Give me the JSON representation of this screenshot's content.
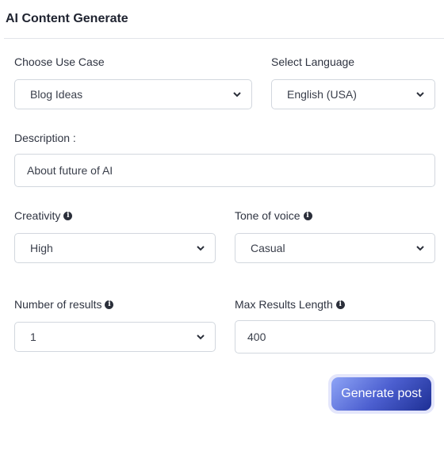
{
  "header": {
    "title": "AI Content Generate"
  },
  "form": {
    "use_case": {
      "label": "Choose Use Case",
      "value": "Blog Ideas"
    },
    "language": {
      "label": "Select Language",
      "value": "English (USA)"
    },
    "description": {
      "label": "Description :",
      "value": "About future of AI"
    },
    "creativity": {
      "label": "Creativity",
      "value": "High"
    },
    "tone": {
      "label": "Tone of voice",
      "value": "Casual"
    },
    "num_results": {
      "label": "Number of results",
      "value": "1"
    },
    "max_length": {
      "label": "Max Results Length",
      "value": "400"
    }
  },
  "actions": {
    "generate_label": "Generate post"
  },
  "icons": {
    "info": "i"
  }
}
